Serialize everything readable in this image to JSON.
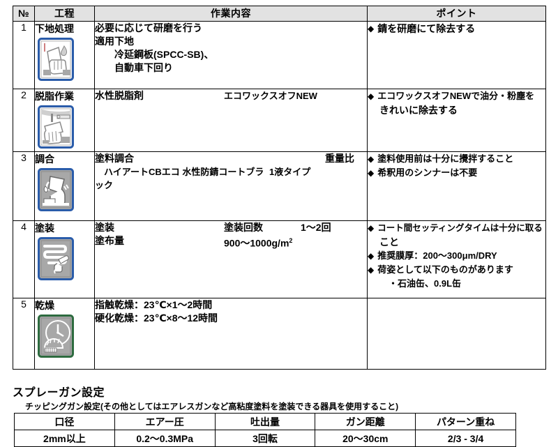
{
  "table": {
    "headers": {
      "no": "№",
      "step": "工程",
      "work": "作業内容",
      "point": "ポイント"
    },
    "rows": [
      {
        "no": "1",
        "step": "下地処理",
        "icon": "sanding-hand-icon",
        "icon_border": "#2a5caa",
        "work": [
          "必要に応じて研磨を行う",
          "適用下地",
          "　　冷延鋼板(SPCC-SB)、",
          "　　自動車下回り"
        ],
        "points": [
          {
            "text": "錆を研磨にて除去する",
            "cont": []
          }
        ]
      },
      {
        "no": "2",
        "step": "脱脂作業",
        "icon": "wiping-cloth-icon",
        "icon_border": "#2a5caa",
        "work_cols": [
          {
            "c1": "水性脱脂剤",
            "c2": "エコワックスオフNEW",
            "c3": ""
          }
        ],
        "points": [
          {
            "text": "エコワックスオフNEWで油分・粉塵を",
            "cont": [
              "きれいに除去する"
            ]
          }
        ]
      },
      {
        "no": "3",
        "step": "調合",
        "icon": "pouring-mix-icon",
        "icon_border": "#2a5caa",
        "work_cols": [
          {
            "c1": "塗料調合",
            "c2": "",
            "c3": "重量比"
          },
          {
            "c1": "　ハイアートCBエコ 水性防錆コートブラック",
            "c2": "",
            "c3": "1液タイプ"
          }
        ],
        "points": [
          {
            "text": "塗料使用前は十分に攪拌すること",
            "cont": []
          },
          {
            "text": "希釈用のシンナーは不要",
            "cont": []
          }
        ]
      },
      {
        "no": "4",
        "step": "塗装",
        "icon": "spray-pattern-icon",
        "icon_border": "#2a5caa",
        "work_cols": [
          {
            "c1": "塗装",
            "c2": "塗装回数",
            "c3": "1～2回"
          },
          {
            "c1": "塗布量",
            "c2": "900～1000g/m2",
            "c3": ""
          }
        ],
        "points": [
          {
            "text": "コート間セッティングタイムは十分に取る",
            "cont": [
              "こと"
            ]
          },
          {
            "text": "推奨膜厚：200～300μm/DRY",
            "cont": []
          },
          {
            "text": "荷姿として以下のものがあります",
            "cont": [
              "　・石油缶、0.9L缶"
            ]
          }
        ]
      },
      {
        "no": "5",
        "step": "乾燥",
        "icon": "drying-clock-icon",
        "icon_border": "#2d6b3f",
        "work": [
          "指触乾燥：23℃×1～2時間",
          "硬化乾燥：23℃×8～12時間"
        ],
        "points": []
      }
    ]
  },
  "spray": {
    "title": "スプレーガン設定",
    "note": "チッピングガン設定(その他としてはエアレスガンなど高粘度塗料を塗装できる器具を使用すること)",
    "headers": [
      "口径",
      "エアー圧",
      "吐出量",
      "ガン距離",
      "パターン重ね"
    ],
    "values": [
      "2mm以上",
      "0.2～0.3MPa",
      "3回転",
      "20～30cm",
      "2/3 - 3/4"
    ]
  },
  "colors": {
    "header_bg": "#e2e2e2",
    "border": "#000000",
    "icon_blue": "#2a5caa",
    "icon_green": "#2d6b3f",
    "icon_fill": "#a8a8a8"
  }
}
